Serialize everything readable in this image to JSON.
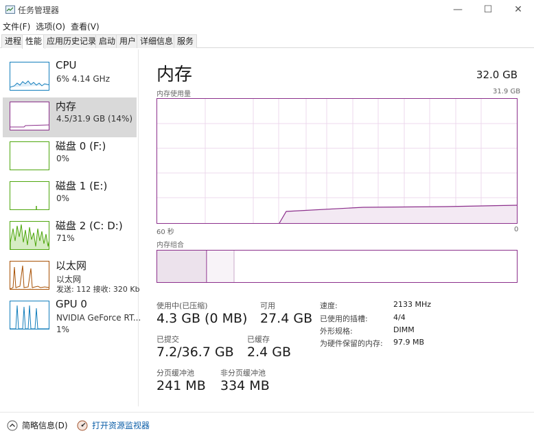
{
  "window": {
    "title": "任务管理器",
    "minimize_glyph": "—",
    "maximize_glyph": "☐",
    "close_glyph": "✕"
  },
  "menu": [
    "文件(F)",
    "选项(O)",
    "查看(V)"
  ],
  "tabs": [
    "进程",
    "性能",
    "应用历史记录",
    "启动",
    "用户",
    "详细信息",
    "服务"
  ],
  "active_tab": "性能",
  "sidebar": {
    "items": [
      {
        "title": "CPU",
        "sub1": "6% 4.14 GHz",
        "sub2": "",
        "sub3": "",
        "color": "#117dbb"
      },
      {
        "title": "内存",
        "sub1": "4.5/31.9 GB (14%)",
        "sub2": "",
        "sub3": "",
        "color": "#8b2e8b"
      },
      {
        "title": "磁盘 0 (F:)",
        "sub1": "0%",
        "sub2": "",
        "sub3": "",
        "color": "#4da60c"
      },
      {
        "title": "磁盘 1 (E:)",
        "sub1": "0%",
        "sub2": "",
        "sub3": "",
        "color": "#4da60c"
      },
      {
        "title": "磁盘 2 (C: D:)",
        "sub1": "71%",
        "sub2": "",
        "sub3": "",
        "color": "#4da60c"
      },
      {
        "title": "以太网",
        "sub1": "以太网",
        "sub2": "发送: 112 接收: 320 Kb",
        "sub3": "",
        "color": "#a74f01"
      },
      {
        "title": "GPU 0",
        "sub1": "NVIDIA GeForce RT...",
        "sub2": "1%",
        "sub3": "",
        "color": "#117dbb"
      }
    ]
  },
  "main": {
    "title": "内存",
    "total": "32.0 GB",
    "usage_label": "内存使用量",
    "usage_max": "31.9 GB",
    "axis_left": "60 秒",
    "axis_right": "0",
    "composition_label": "内存组合"
  },
  "stats": {
    "in_use_label": "使用中(已压缩)",
    "in_use_value": "4.3 GB (0 MB)",
    "available_label": "可用",
    "available_value": "27.4 GB",
    "committed_label": "已提交",
    "committed_value": "7.2/36.7 GB",
    "cached_label": "已缓存",
    "cached_value": "2.4 GB",
    "paged_label": "分页缓冲池",
    "paged_value": "241 MB",
    "nonpaged_label": "非分页缓冲池",
    "nonpaged_value": "334 MB"
  },
  "specs": [
    {
      "label": "速度:",
      "value": "2133 MHz"
    },
    {
      "label": "已使用的插槽:",
      "value": "4/4"
    },
    {
      "label": "外形规格:",
      "value": "DIMM"
    },
    {
      "label": "为硬件保留的内存:",
      "value": "97.9 MB"
    }
  ],
  "footer": {
    "brief_label": "简略信息(D)",
    "monitor_label": "打开资源监视器"
  }
}
